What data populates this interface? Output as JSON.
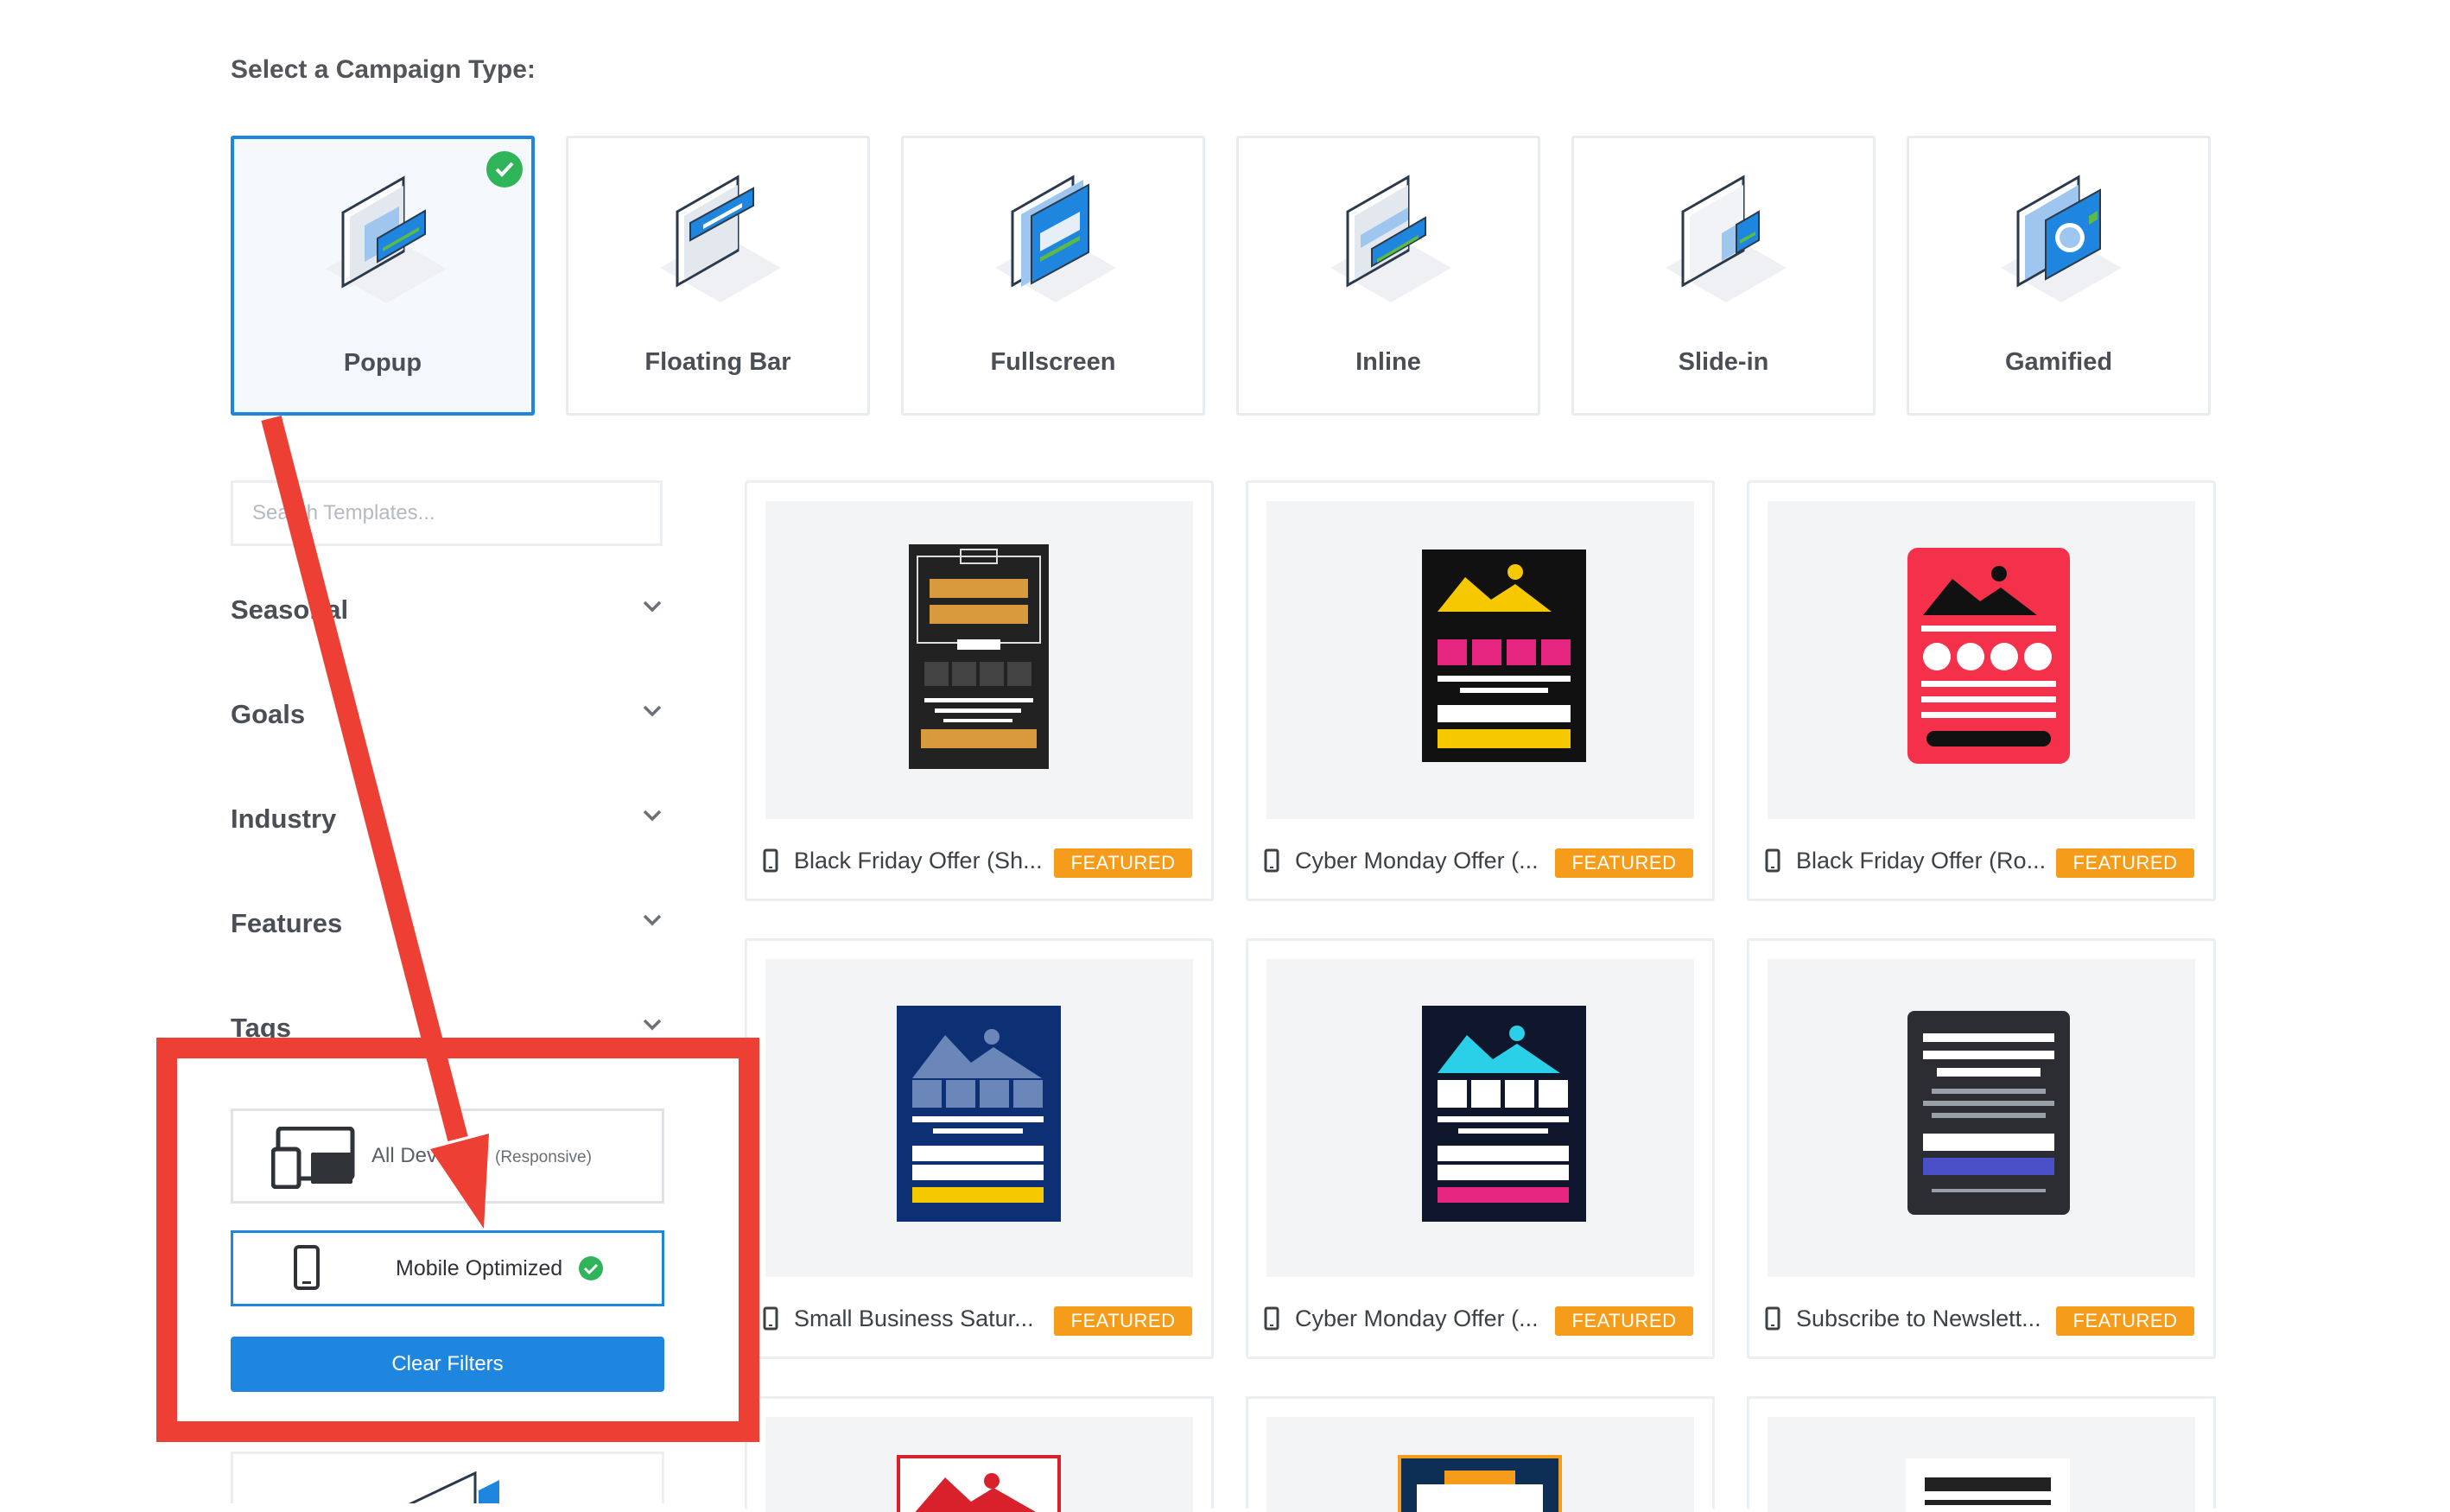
{
  "heading": "Select a Campaign Type:",
  "campaign_types": [
    {
      "label": "Popup",
      "selected": true
    },
    {
      "label": "Floating Bar",
      "selected": false
    },
    {
      "label": "Fullscreen",
      "selected": false
    },
    {
      "label": "Inline",
      "selected": false
    },
    {
      "label": "Slide-in",
      "selected": false
    },
    {
      "label": "Gamified",
      "selected": false
    }
  ],
  "search": {
    "placeholder": "Search Templates..."
  },
  "filters": [
    "Seasonal",
    "Goals",
    "Industry",
    "Features",
    "Tags"
  ],
  "devices": {
    "all_label": "All Devices",
    "all_note": "(Responsive)",
    "mobile_label": "Mobile Optimized"
  },
  "clear_filters": "Clear Filters",
  "badge": "FEATURED",
  "templates": [
    {
      "name": "Black Friday Offer (Sh...",
      "badge": "FEATURED"
    },
    {
      "name": "Cyber Monday Offer (...",
      "badge": "FEATURED"
    },
    {
      "name": "Black Friday Offer (Ro...",
      "badge": "FEATURED"
    },
    {
      "name": "Small Business Satur...",
      "badge": "FEATURED"
    },
    {
      "name": "Cyber Monday Offer (...",
      "badge": "FEATURED"
    },
    {
      "name": "Subscribe to Newslett...",
      "badge": "FEATURED"
    }
  ],
  "colors": {
    "accent": "#1f86e0",
    "badge": "#f59d1b",
    "annotation": "#ee3f34",
    "check": "#2fb45a"
  }
}
